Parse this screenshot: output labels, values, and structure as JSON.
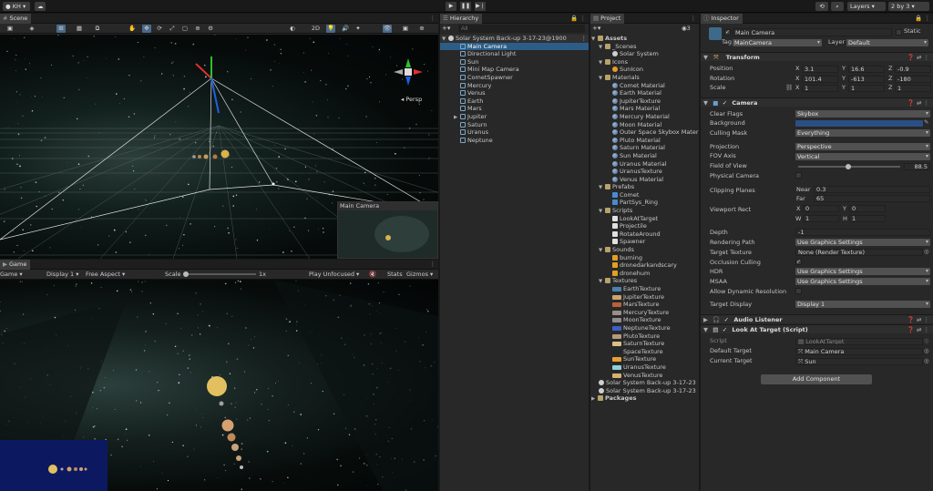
{
  "topbar": {
    "account": "KH",
    "play_icon": "play-icon",
    "pause_icon": "pause-icon",
    "step_icon": "step-icon",
    "layers": "Layers",
    "layout": "2 by 3"
  },
  "scene": {
    "tab_label": "Scene",
    "mode_2d": "2D",
    "view_label": "Persp",
    "camera_preview_label": "Main Camera"
  },
  "game": {
    "tab_label": "Game",
    "view_mode": "Game",
    "display": "Display 1",
    "aspect": "Free Aspect",
    "scale_label": "Scale",
    "scale_value": "1x",
    "play_mode": "Play Unfocused",
    "stats": "Stats",
    "gizmos": "Gizmos"
  },
  "hierarchy": {
    "tab_label": "Hierarchy",
    "search_placeholder": "All",
    "scene_name": "Solar System Back-up 3-17-23@1900",
    "items": [
      {
        "label": "Main Camera",
        "selected": true,
        "expandable": false
      },
      {
        "label": "Directional Light",
        "selected": false,
        "expandable": false
      },
      {
        "label": "Sun",
        "selected": false,
        "expandable": false
      },
      {
        "label": "Mini Map Camera",
        "selected": false,
        "expandable": false
      },
      {
        "label": "CometSpawner",
        "selected": false,
        "expandable": false
      },
      {
        "label": "Mercury",
        "selected": false,
        "expandable": false
      },
      {
        "label": "Venus",
        "selected": false,
        "expandable": false
      },
      {
        "label": "Earth",
        "selected": false,
        "expandable": false
      },
      {
        "label": "Mars",
        "selected": false,
        "expandable": false
      },
      {
        "label": "Jupiter",
        "selected": false,
        "expandable": true
      },
      {
        "label": "Saturn",
        "selected": false,
        "expandable": false
      },
      {
        "label": "Uranus",
        "selected": false,
        "expandable": false
      },
      {
        "label": "Neptune",
        "selected": false,
        "expandable": false
      }
    ]
  },
  "project": {
    "tab_label": "Project",
    "assets_label": "Assets",
    "packages_label": "Packages",
    "badge_count": "3",
    "folders": [
      {
        "name": "_Scenes",
        "items": [
          {
            "label": "Solar System",
            "type": "scene"
          }
        ]
      },
      {
        "name": "Icons",
        "items": [
          {
            "label": "SunIcon",
            "type": "icon"
          }
        ]
      },
      {
        "name": "Materials",
        "items": [
          {
            "label": "Comet Material",
            "type": "material"
          },
          {
            "label": "Earth Material",
            "type": "material"
          },
          {
            "label": "JupiterTexture",
            "type": "material"
          },
          {
            "label": "Mars Material",
            "type": "material"
          },
          {
            "label": "Mercury Material",
            "type": "material"
          },
          {
            "label": "Moon Material",
            "type": "material"
          },
          {
            "label": "Outer Space Skybox Materia",
            "type": "material"
          },
          {
            "label": "Pluto Material",
            "type": "material"
          },
          {
            "label": "Saturn Material",
            "type": "material"
          },
          {
            "label": "Sun Material",
            "type": "material"
          },
          {
            "label": "Uranus Material",
            "type": "material"
          },
          {
            "label": "UranusTexture",
            "type": "material"
          },
          {
            "label": "Venus Material",
            "type": "material"
          }
        ]
      },
      {
        "name": "Prefabs",
        "items": [
          {
            "label": "Comet",
            "type": "prefab"
          },
          {
            "label": "PartSys_Ring",
            "type": "prefab"
          }
        ]
      },
      {
        "name": "Scripts",
        "items": [
          {
            "label": "LookAtTarget",
            "type": "script"
          },
          {
            "label": "Projectile",
            "type": "script"
          },
          {
            "label": "RotateAround",
            "type": "script"
          },
          {
            "label": "Spawner",
            "type": "script"
          }
        ]
      },
      {
        "name": "Sounds",
        "items": [
          {
            "label": "burning",
            "type": "sound"
          },
          {
            "label": "dronedarkandscary",
            "type": "sound"
          },
          {
            "label": "dronehum",
            "type": "sound"
          }
        ]
      },
      {
        "name": "Textures",
        "items": [
          {
            "label": "EarthTexture",
            "type": "texture",
            "color": "#4a7fb0"
          },
          {
            "label": "JupiterTexture",
            "type": "texture",
            "color": "#c9a46e"
          },
          {
            "label": "MarsTexture",
            "type": "texture",
            "color": "#b8623a"
          },
          {
            "label": "MercuryTexture",
            "type": "texture",
            "color": "#9a8f86"
          },
          {
            "label": "MoonTexture",
            "type": "texture",
            "color": "#8e8e8e"
          },
          {
            "label": "NeptuneTexture",
            "type": "texture",
            "color": "#3c5fc8"
          },
          {
            "label": "PlutoTexture",
            "type": "texture",
            "color": "#b49a7c"
          },
          {
            "label": "SaturnTexture",
            "type": "texture",
            "color": "#d8c08a"
          },
          {
            "label": "SpaceTexture",
            "type": "texture",
            "color": "#202828"
          },
          {
            "label": "SunTexture",
            "type": "texture",
            "color": "#e8a030"
          },
          {
            "label": "UranusTexture",
            "type": "texture",
            "color": "#8fd0d8"
          },
          {
            "label": "VenusTexture",
            "type": "texture",
            "color": "#d8b070"
          }
        ]
      }
    ],
    "root_scenes": [
      "Solar System Back-up 3-17-23",
      "Solar System Back-up 3-17-23"
    ]
  },
  "inspector": {
    "tab_label": "Inspector",
    "object_name": "Main Camera",
    "static_label": "Static",
    "tag_label": "Tag",
    "tag_value": "MainCamera",
    "layer_label": "Layer",
    "layer_value": "Default",
    "transform": {
      "title": "Transform",
      "position_label": "Position",
      "rotation_label": "Rotation",
      "scale_label": "Scale",
      "position": [
        "3.1",
        "16.6",
        "-0.9"
      ],
      "rotation": [
        "101.4",
        "-613",
        "-180"
      ],
      "scale": [
        "1",
        "1",
        "1"
      ]
    },
    "camera": {
      "title": "Camera",
      "clear_flags_label": "Clear Flags",
      "clear_flags": "Skybox",
      "background_label": "Background",
      "background_color": "#2b4f84",
      "culling_mask_label": "Culling Mask",
      "culling_mask": "Everything",
      "projection_label": "Projection",
      "projection": "Perspective",
      "fov_axis_label": "FOV Axis",
      "fov_axis": "Vertical",
      "fov_label": "Field of View",
      "fov_value": "88.5",
      "fov_fraction": 0.49,
      "physical_label": "Physical Camera",
      "clipping_label": "Clipping Planes",
      "near_label": "Near",
      "near": "0.3",
      "far_label": "Far",
      "far": "65",
      "viewport_label": "Viewport Rect",
      "viewport_x": "0",
      "viewport_y": "0",
      "viewport_w": "1",
      "viewport_h": "1",
      "depth_label": "Depth",
      "depth": "-1",
      "rendering_path_label": "Rendering Path",
      "rendering_path": "Use Graphics Settings",
      "target_texture_label": "Target Texture",
      "target_texture": "None (Render Texture)",
      "occlusion_label": "Occlusion Culling",
      "hdr_label": "HDR",
      "hdr": "Use Graphics Settings",
      "msaa_label": "MSAA",
      "msaa": "Use Graphics Settings",
      "dynres_label": "Allow Dynamic Resolution",
      "target_display_label": "Target Display",
      "target_display": "Display 1"
    },
    "audio_listener_title": "Audio Listener",
    "look_at": {
      "title": "Look At Target (Script)",
      "script_label": "Script",
      "script_value": "LookAtTarget",
      "default_target_label": "Default Target",
      "default_target": "Main Camera",
      "current_target_label": "Current Target",
      "current_target": "Sun"
    },
    "add_component": "Add Component"
  }
}
